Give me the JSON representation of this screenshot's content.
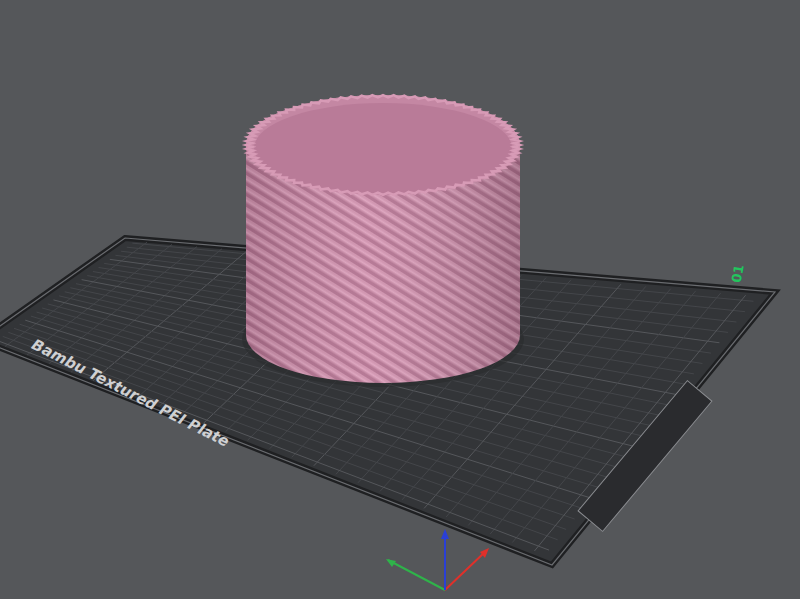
{
  "plate": {
    "name": "Bambu Textured PEI Plate",
    "index": "01"
  }
}
